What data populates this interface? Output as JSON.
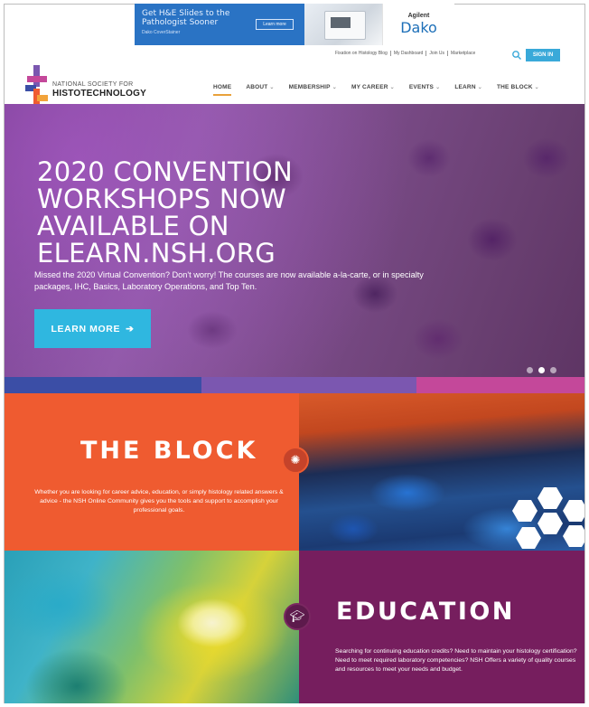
{
  "ad": {
    "line1": "Get H&E Slides to the",
    "line2": "Pathologist Sooner",
    "line3": "Dako CoverStainer",
    "button": "Learn more",
    "brand_top": "Agilent",
    "brand_main": "Dako"
  },
  "utility": {
    "links": [
      "Fixation on Histology Blog",
      "My Dashboard",
      "Join Us",
      "Marketplace"
    ],
    "signin": "SIGN IN"
  },
  "logo": {
    "line1": "NATIONAL SOCIETY FOR",
    "line2": "HISTOTECHNOLOGY"
  },
  "nav": {
    "items": [
      {
        "label": "HOME",
        "active": true,
        "dropdown": false
      },
      {
        "label": "ABOUT",
        "active": false,
        "dropdown": true
      },
      {
        "label": "MEMBERSHIP",
        "active": false,
        "dropdown": true
      },
      {
        "label": "MY CAREER",
        "active": false,
        "dropdown": true
      },
      {
        "label": "EVENTS",
        "active": false,
        "dropdown": true
      },
      {
        "label": "LEARN",
        "active": false,
        "dropdown": true
      },
      {
        "label": "THE BLOCK",
        "active": false,
        "dropdown": true
      }
    ]
  },
  "hero": {
    "title_lines": [
      "2020 CONVENTION",
      "WORKSHOPS NOW",
      "AVAILABLE ON",
      "ELEARN.NSH.ORG"
    ],
    "subtitle": "Missed the 2020 Virtual Convention? Don't worry! The courses are now available a-la-carte, or in specialty packages, IHC, Basics, Laboratory Operations, and Top Ten.",
    "button": "LEARN MORE",
    "slides": 3,
    "active_slide": 2
  },
  "colors": {
    "strip": [
      "#3b4ea6",
      "#7b57b0",
      "#c4489a"
    ],
    "block": "#ef5b30",
    "education": "#761e5e",
    "accent": "#2fb7e0"
  },
  "block": {
    "title": "THE BLOCK",
    "text": "Whether you are looking for career advice, education, or simply histology related answers & advice - the NSH Online Community gives you the tools and support to accomplish your professional goals."
  },
  "education": {
    "title": "EDUCATION",
    "text": "Searching for continuing education credits? Need to maintain your histology certification? Need to meet required laboratory competencies? NSH Offers a variety of quality courses and resources to meet your needs and budget."
  }
}
